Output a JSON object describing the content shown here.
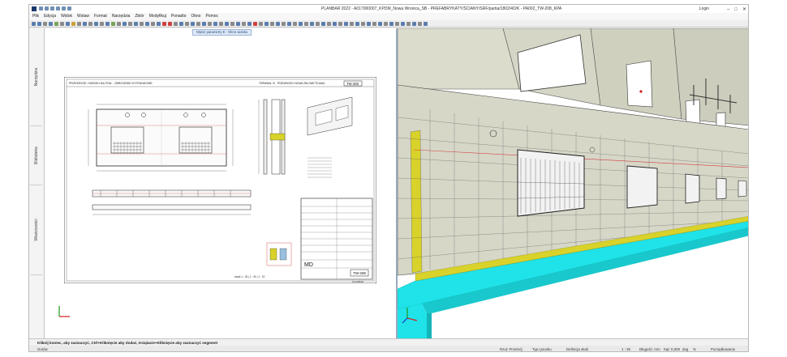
{
  "window": {
    "title": "PLANBAR 2022 - A017000007_KPDM_Nowa Wronica_SB - PREFABRYKATY/ŚCIANY/SRF/partia/1802/4D/K - PA002_TW-208_KPA",
    "login_label": "Login"
  },
  "menu": [
    "Plik",
    "Edycja",
    "Widok",
    "Wstaw",
    "Format",
    "Narzędzia",
    "Zbiór",
    "Modyfikuj",
    "Ponadto",
    "Okno",
    "Pomoc"
  ],
  "left_tabs": [
    "Narzędzia",
    "Biblioteka",
    "Właściwości"
  ],
  "view_hint": "Wpisz parametry E - Okno widoku",
  "drawing": {
    "header_title": "PRZEKROJE I WIDOKI NA STAL - ZBROJENIE DYSTANSOWE",
    "header_sub": "TERMINAL III - TRZEWNOSCI NOWA ZBLOWE ŚCIANA",
    "element_code": "TW-208",
    "footer_note": "skala 1 : 25 | 1 : 50 | 1 : 20",
    "company": "MD",
    "planbar_tag": "PLANBAR"
  },
  "status": {
    "prompt": "Kliknij koniec, aby zaznaczyć, Ctrl+Kliknięcie aby dodać, Ksiąlacie+Kliknięcie aby zaznaczyć segment"
  },
  "bottom": {
    "state": "Gotów",
    "projection_label": "Rzut: Przekrój",
    "draw_type_label": "Typ rysunku",
    "draw_type_value": "Definicja skali",
    "scale": "1 : 25",
    "length_unit": "Długość: mm",
    "angle_label": "Kąt: 0,000",
    "angle_unit": "deg",
    "pct": "%",
    "mode": "Porządkowanie"
  },
  "colors": {
    "accent": "#2b5797",
    "wall_face": "#d9d9cc",
    "floor_cyan": "#1fe3e8",
    "insulation_yellow": "#d8d22a",
    "grid_line": "#6b6b6b",
    "sky_white": "#ffffff"
  }
}
